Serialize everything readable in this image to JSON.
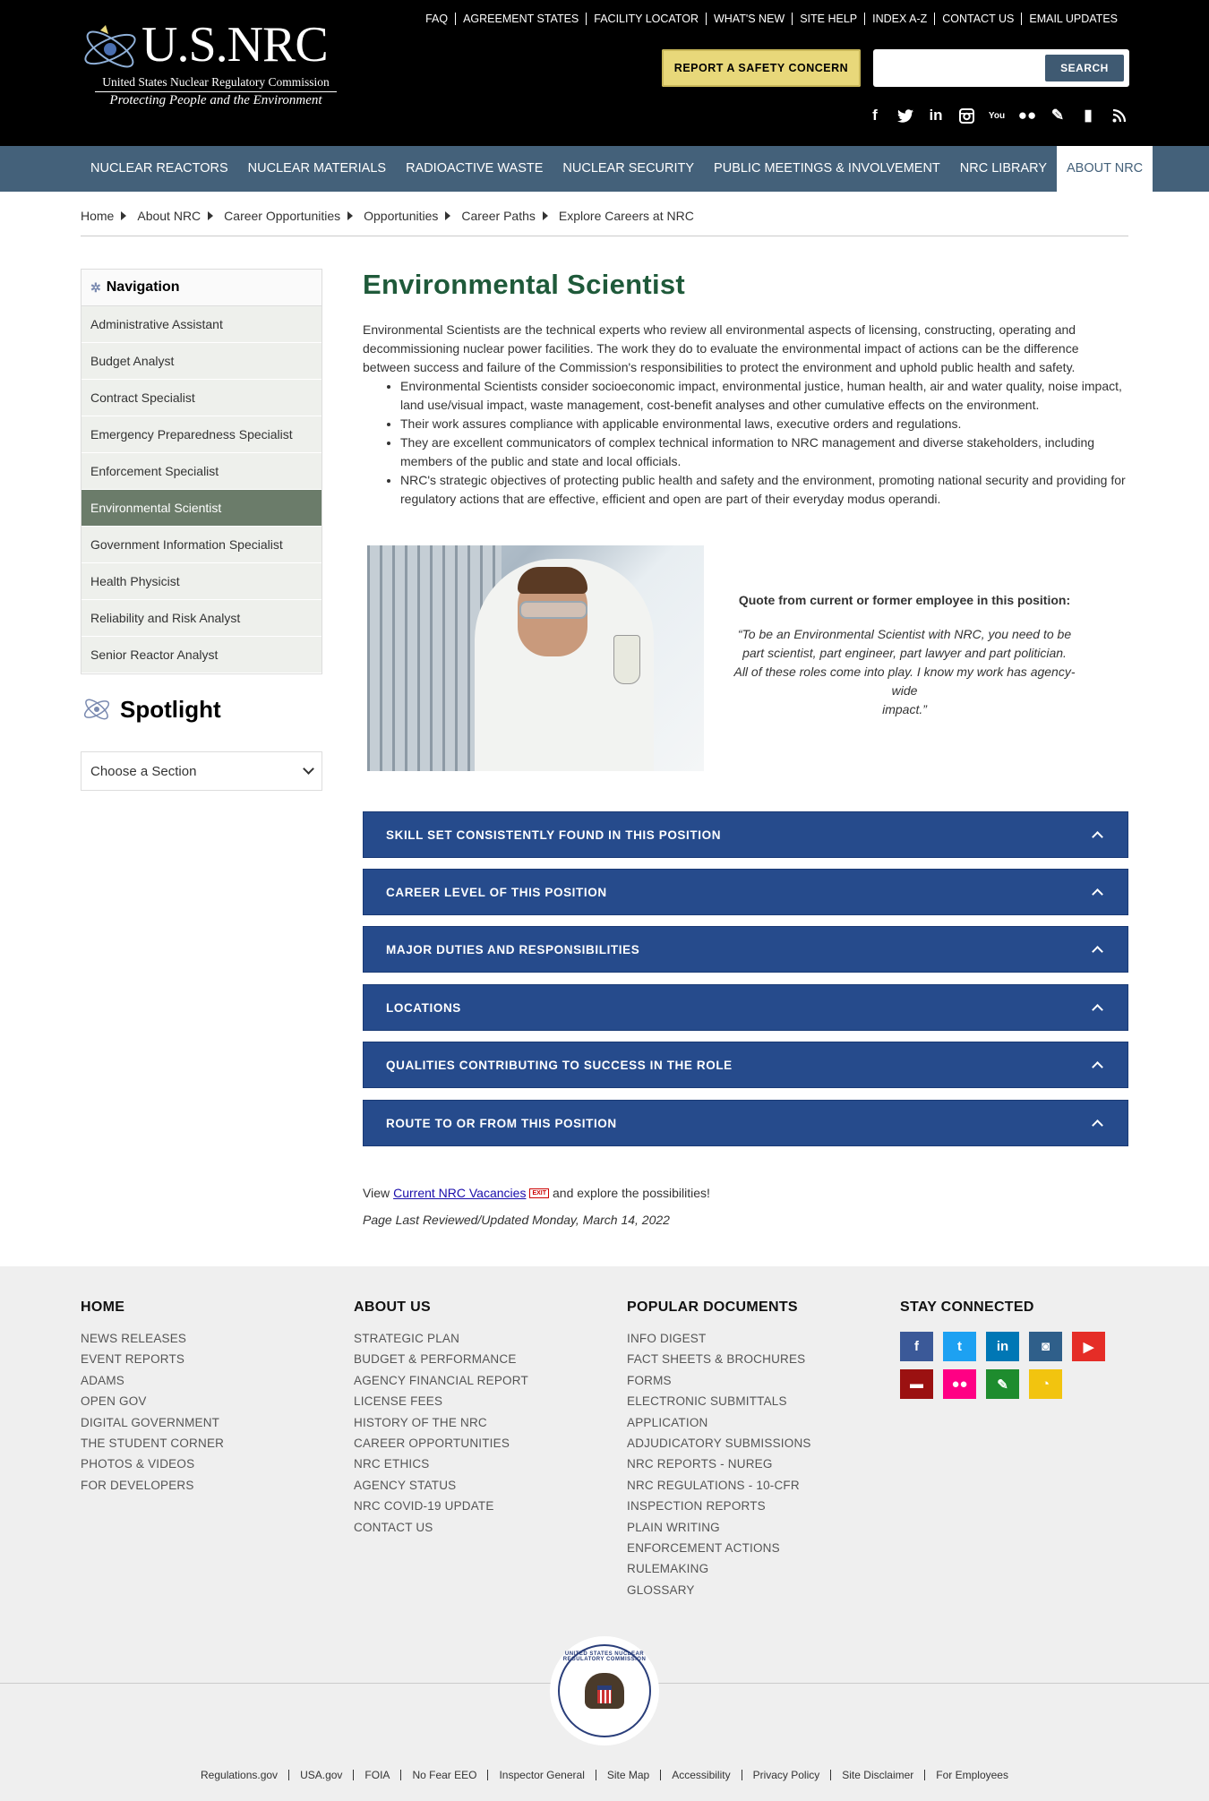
{
  "header": {
    "logo": {
      "name": "U.S.NRC",
      "subtitle": "United States Nuclear Regulatory Commission",
      "tagline": "Protecting People and the Environment"
    },
    "utility_links": [
      "FAQ",
      "AGREEMENT STATES",
      "FACILITY LOCATOR",
      "WHAT'S NEW",
      "SITE HELP",
      "INDEX A-Z",
      "CONTACT US",
      "EMAIL UPDATES"
    ],
    "report_button": "REPORT A SAFETY CONCERN",
    "search": {
      "placeholder": "",
      "button": "SEARCH"
    },
    "social_icons": [
      "facebook-icon",
      "twitter-icon",
      "linkedin-icon",
      "instagram-icon",
      "youtube-icon",
      "flickr-icon",
      "pen-icon",
      "comment-icon",
      "rss-icon"
    ]
  },
  "main_nav": [
    {
      "label": "NUCLEAR REACTORS",
      "active": false
    },
    {
      "label": "NUCLEAR MATERIALS",
      "active": false
    },
    {
      "label": "RADIOACTIVE WASTE",
      "active": false
    },
    {
      "label": "NUCLEAR SECURITY",
      "active": false
    },
    {
      "label": "PUBLIC MEETINGS & INVOLVEMENT",
      "active": false
    },
    {
      "label": "NRC LIBRARY",
      "active": false
    },
    {
      "label": "ABOUT NRC",
      "active": true
    }
  ],
  "breadcrumb": [
    "Home",
    "About NRC",
    "Career Opportunities",
    "Opportunities",
    "Career Paths",
    "Explore Careers at NRC"
  ],
  "sidebar": {
    "title": "Navigation",
    "items": [
      {
        "label": "Administrative Assistant",
        "active": false
      },
      {
        "label": "Budget Analyst",
        "active": false
      },
      {
        "label": "Contract Specialist",
        "active": false
      },
      {
        "label": "Emergency Preparedness Specialist",
        "active": false
      },
      {
        "label": "Enforcement Specialist",
        "active": false
      },
      {
        "label": "Environmental Scientist",
        "active": true
      },
      {
        "label": "Government Information Specialist",
        "active": false
      },
      {
        "label": "Health Physicist",
        "active": false
      },
      {
        "label": "Reliability and Risk Analyst",
        "active": false
      },
      {
        "label": "Senior Reactor Analyst",
        "active": false
      }
    ],
    "spotlight_title": "Spotlight",
    "section_select": "Choose a Section"
  },
  "content": {
    "title": "Environmental Scientist",
    "intro": "Environmental Scientists are the technical experts who review all environmental aspects of licensing, constructing, operating and decommissioning nuclear power facilities.  The work they do to evaluate the environmental impact of actions can be the difference between success and failure of the Commission's responsibilities to protect the environment and uphold public health and safety.",
    "bullets": [
      "Environmental Scientists consider socioeconomic impact, environmental justice, human health, air and water quality, noise impact, land use/visual impact, waste management, cost-benefit analyses and other cumulative effects on the environment.",
      "Their work assures compliance with applicable environmental laws, executive orders and regulations.",
      "They are excellent communicators of complex technical information to NRC management and diverse stakeholders, including members of the public and state and local officials.",
      "NRC's strategic objectives of protecting public health and safety and the environment, promoting national security and providing for regulatory actions that are effective, efficient and open are part of their everyday modus operandi."
    ],
    "quote_heading": "Quote from current or former employee in this position:",
    "quote_lines": [
      "“To be an Environmental Scientist with NRC, you need to be",
      "part scientist, part engineer, part lawyer and part politician.",
      "All of these roles come into play.  I know my work has agency-wide",
      "impact.”"
    ],
    "accordions": [
      "SKILL SET CONSISTENTLY FOUND IN THIS POSITION",
      "CAREER LEVEL OF THIS POSITION",
      "MAJOR DUTIES AND RESPONSIBILITIES",
      "LOCATIONS",
      "QUALITIES CONTRIBUTING TO SUCCESS IN THE ROLE",
      "ROUTE TO OR FROM THIS POSITION"
    ],
    "vacancies_prefix": "View",
    "vacancies_link": "Current NRC Vacancies",
    "exit_badge": "EXIT",
    "vacancies_suffix": "and explore the possibilities!",
    "last_reviewed": "Page Last Reviewed/Updated Monday, March 14, 2022"
  },
  "footer": {
    "columns": [
      {
        "title": "HOME",
        "links": [
          "NEWS RELEASES",
          "EVENT REPORTS",
          "ADAMS",
          "OPEN GOV",
          "DIGITAL GOVERNMENT",
          "THE STUDENT CORNER",
          "PHOTOS & VIDEOS",
          "FOR DEVELOPERS"
        ]
      },
      {
        "title": "ABOUT US",
        "links": [
          "STRATEGIC PLAN",
          "BUDGET & PERFORMANCE",
          "AGENCY FINANCIAL REPORT",
          "LICENSE FEES",
          "HISTORY OF THE NRC",
          "CAREER OPPORTUNITIES",
          "NRC ETHICS",
          "AGENCY STATUS",
          "NRC COVID-19 UPDATE",
          "CONTACT US"
        ]
      },
      {
        "title": "POPULAR DOCUMENTS",
        "links": [
          "INFO DIGEST",
          "FACT SHEETS & BROCHURES",
          "FORMS",
          "ELECTRONIC SUBMITTALS",
          "APPLICATION",
          "ADJUDICATORY SUBMISSIONS",
          "NRC REPORTS - NUREG",
          "NRC REGULATIONS - 10-CFR",
          "INSPECTION REPORTS",
          "PLAIN WRITING",
          "ENFORCEMENT ACTIONS",
          "RULEMAKING",
          "GLOSSARY"
        ]
      }
    ],
    "stay_connected": "STAY CONNECTED",
    "social": [
      {
        "icon": "facebook-icon",
        "color": "#3b5998"
      },
      {
        "icon": "twitter-icon",
        "color": "#1da1f2"
      },
      {
        "icon": "linkedin-icon",
        "color": "#0077b5"
      },
      {
        "icon": "instagram-icon",
        "color": "#2f5f8a"
      },
      {
        "icon": "youtube-icon",
        "color": "#e52d27"
      },
      {
        "icon": "comment-icon",
        "color": "#9b1111"
      },
      {
        "icon": "flickr-icon",
        "color": "#ff0084"
      },
      {
        "icon": "pen-icon",
        "color": "#1e8c2e"
      },
      {
        "icon": "rss-icon",
        "color": "#f2c40f"
      }
    ],
    "seal_text": "UNITED STATES NUCLEAR REGULATORY COMMISSION",
    "bottom_links": [
      "Regulations.gov",
      "USA.gov",
      "FOIA",
      "No Fear EEO",
      "Inspector General",
      "Site Map",
      "Accessibility",
      "Privacy Policy",
      "Site Disclaimer",
      "For Employees"
    ]
  }
}
